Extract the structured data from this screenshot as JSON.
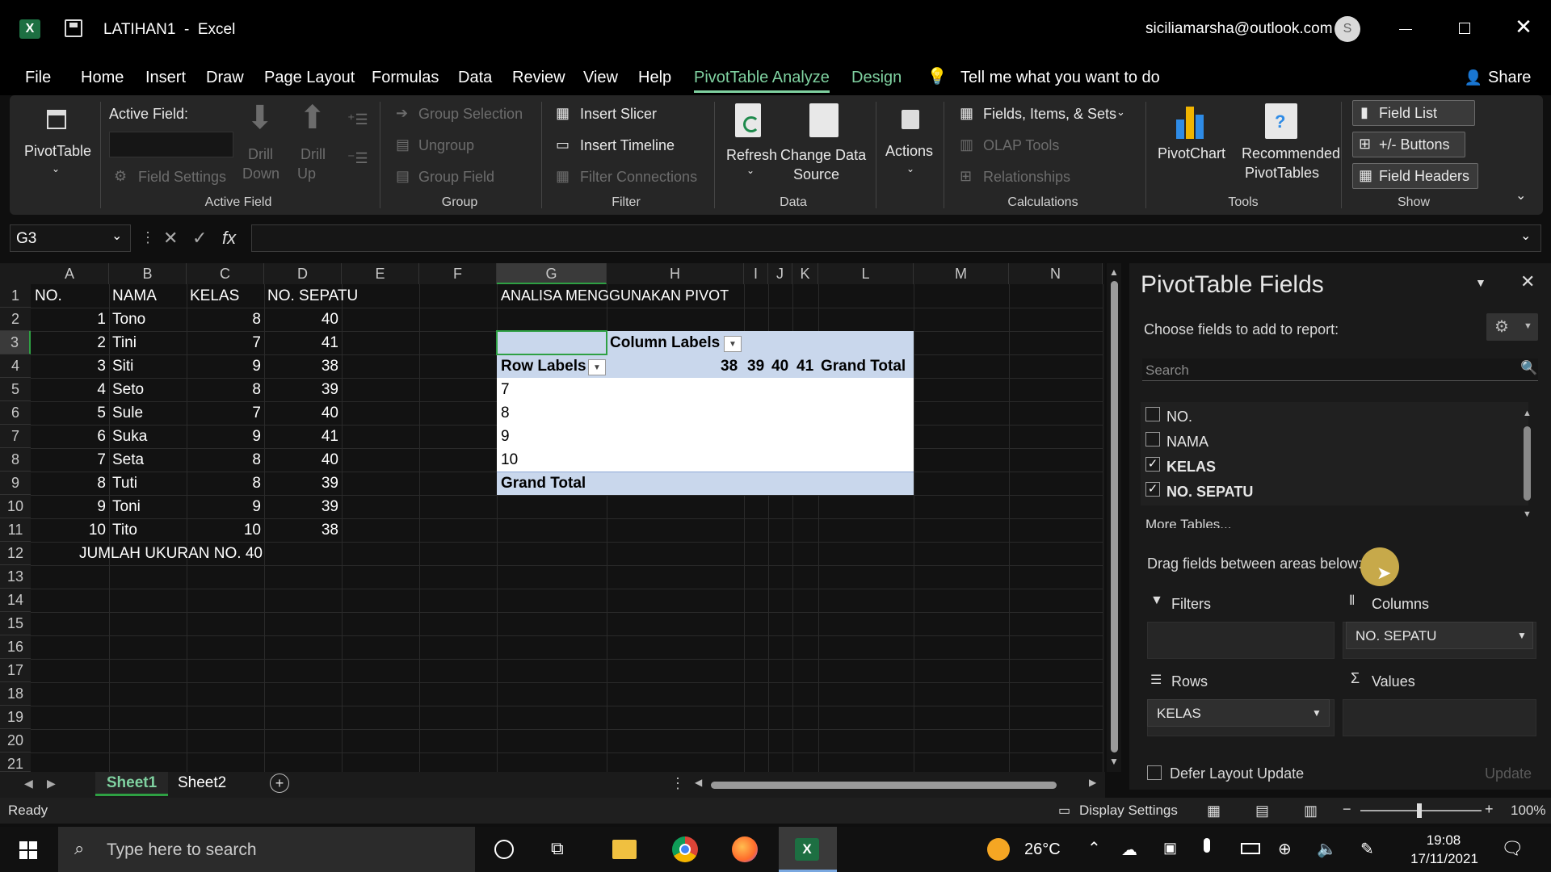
{
  "window": {
    "title": "LATIHAN1  -  Excel",
    "account": "siciliamarsha@outlook.com",
    "avatar_letter": "S"
  },
  "menu": {
    "items": [
      "File",
      "Home",
      "Insert",
      "Draw",
      "Page Layout",
      "Formulas",
      "Data",
      "Review",
      "View",
      "Help",
      "PivotTable Analyze",
      "Design"
    ],
    "tell_me": "Tell me what you want to do",
    "share": "Share"
  },
  "ribbon": {
    "pivottable": "PivotTable",
    "active_field_label": "Active Field:",
    "field_settings": "Field Settings",
    "drill_down": [
      "Drill",
      "Down"
    ],
    "drill_up": [
      "Drill",
      "Up"
    ],
    "group_selection": "Group Selection",
    "ungroup": "Ungroup",
    "group_field": "Group Field",
    "insert_slicer": "Insert Slicer",
    "insert_timeline": "Insert Timeline",
    "filter_connections": "Filter Connections",
    "refresh": "Refresh",
    "change_data_source": [
      "Change Data",
      "Source"
    ],
    "actions": "Actions",
    "fields_items_sets": "Fields, Items, & Sets",
    "olap_tools": "OLAP Tools",
    "relationships": "Relationships",
    "pivotchart": "PivotChart",
    "recommended": [
      "Recommended",
      "PivotTables"
    ],
    "field_list": "Field List",
    "buttons": "+/- Buttons",
    "field_headers": "Field Headers",
    "groups": {
      "active_field": "Active Field",
      "group": "Group",
      "filter": "Filter",
      "data": "Data",
      "calculations": "Calculations",
      "tools": "Tools",
      "show": "Show"
    }
  },
  "formula": {
    "name_box": "G3",
    "fx": "fx",
    "value": ""
  },
  "sheet": {
    "columns": [
      "A",
      "B",
      "C",
      "D",
      "E",
      "F",
      "G",
      "H",
      "I",
      "J",
      "K",
      "L",
      "M",
      "N"
    ],
    "rows": [
      "1",
      "2",
      "3",
      "4",
      "5",
      "6",
      "7",
      "8",
      "9",
      "10",
      "11",
      "12",
      "13",
      "14",
      "15",
      "16",
      "17",
      "18",
      "19",
      "20",
      "21"
    ],
    "header": [
      "NO.",
      "NAMA",
      "KELAS",
      "NO. SEPATU"
    ],
    "data": [
      [
        "1",
        "Tono",
        "8",
        "40"
      ],
      [
        "2",
        "Tini",
        "7",
        "41"
      ],
      [
        "3",
        "Siti",
        "9",
        "38"
      ],
      [
        "4",
        "Seto",
        "8",
        "39"
      ],
      [
        "5",
        "Sule",
        "7",
        "40"
      ],
      [
        "6",
        "Suka",
        "9",
        "41"
      ],
      [
        "7",
        "Seta",
        "8",
        "40"
      ],
      [
        "8",
        "Tuti",
        "8",
        "39"
      ],
      [
        "9",
        "Toni",
        "9",
        "39"
      ],
      [
        "10",
        "Tito",
        "10",
        "38"
      ]
    ],
    "jumlah": "JUMLAH UKURAN NO. 40",
    "pivot_title": "ANALISA MENGGUNAKAN PIVOT",
    "column_labels": "Column Labels",
    "row_labels": "Row Labels",
    "col_values": [
      "38",
      "39",
      "40",
      "41"
    ],
    "grand_total_col": "Grand Total",
    "row_values": [
      "7",
      "8",
      "9",
      "10"
    ],
    "grand_total_row": "Grand Total",
    "tabs": [
      "Sheet1",
      "Sheet2"
    ]
  },
  "panel": {
    "title": "PivotTable Fields",
    "choose": "Choose fields to add to report:",
    "search_placeholder": "Search",
    "fields": [
      {
        "name": "NO.",
        "checked": false
      },
      {
        "name": "NAMA",
        "checked": false
      },
      {
        "name": "KELAS",
        "checked": true
      },
      {
        "name": "NO. SEPATU",
        "checked": true
      }
    ],
    "more_tables": "More Tables...",
    "drag": "Drag fields between areas below:",
    "filters": "Filters",
    "columns": "Columns",
    "columns_value": "NO. SEPATU",
    "rows": "Rows",
    "rows_value": "KELAS",
    "values": "Values",
    "defer": "Defer Layout Update",
    "update": "Update"
  },
  "status": {
    "ready": "Ready",
    "display_settings": "Display Settings",
    "zoom": "100%"
  },
  "taskbar": {
    "search": "Type here to search",
    "temp": "26°C",
    "time": "19:08",
    "date": "17/11/2021"
  }
}
